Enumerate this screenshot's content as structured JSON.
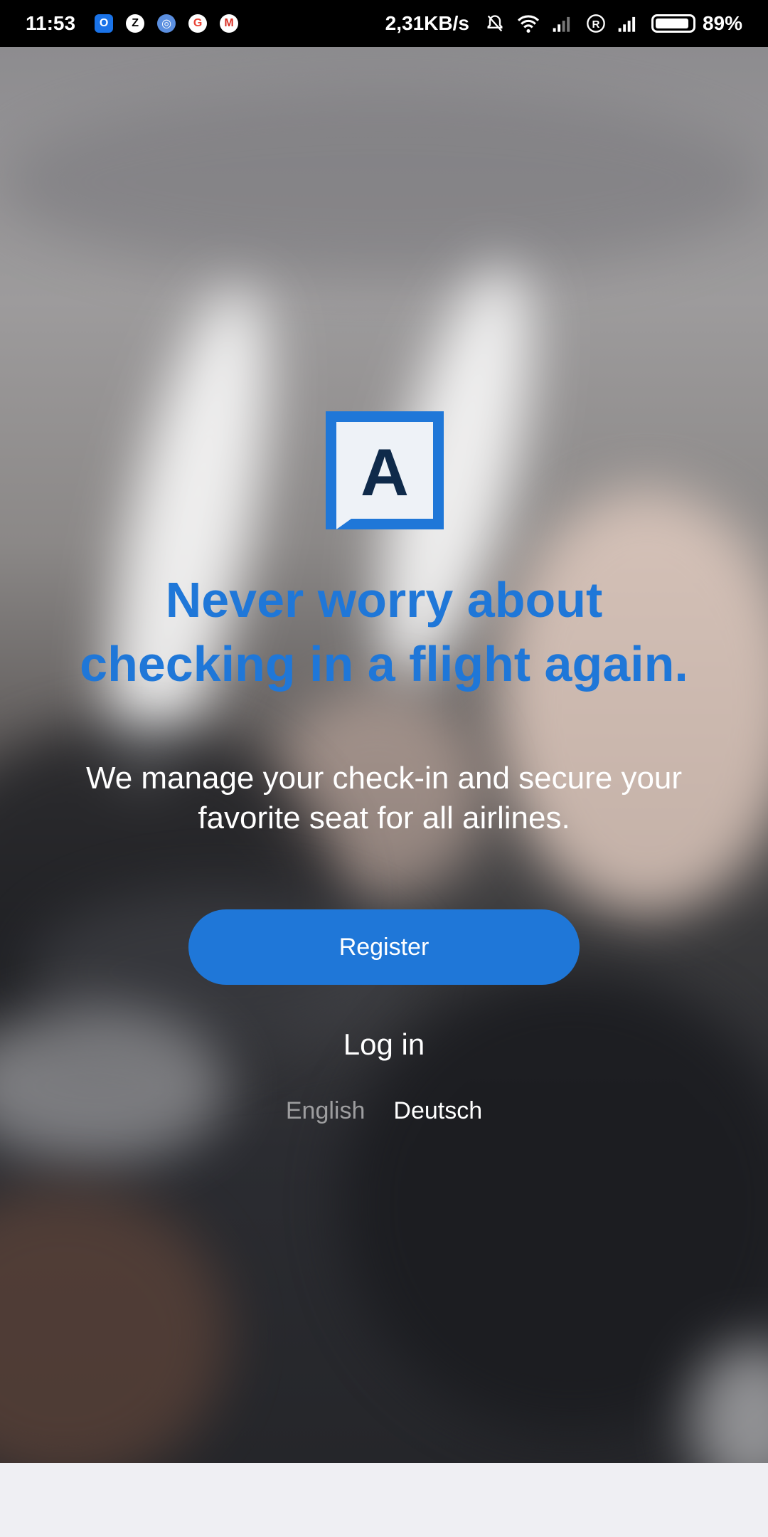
{
  "status_bar": {
    "time": "11:53",
    "notifications": [
      "outlook-icon",
      "z-app-icon",
      "wifi-app-icon",
      "google-icon",
      "gmail-icon"
    ],
    "network_speed": "2,31KB/s",
    "battery": "89%"
  },
  "hero": {
    "logo_letter": "A",
    "headline_line1": "Never worry about",
    "headline_line2": "checking in a flight again.",
    "subtext_line1": "We manage your check-in and secure your",
    "subtext_line2": "favorite seat for all airlines."
  },
  "actions": {
    "register_label": "Register",
    "login_label": "Log in"
  },
  "languages": {
    "english": "English",
    "deutsch": "Deutsch"
  },
  "colors": {
    "brand_blue": "#1f77d8",
    "logo_dark": "#0f2a4a"
  }
}
